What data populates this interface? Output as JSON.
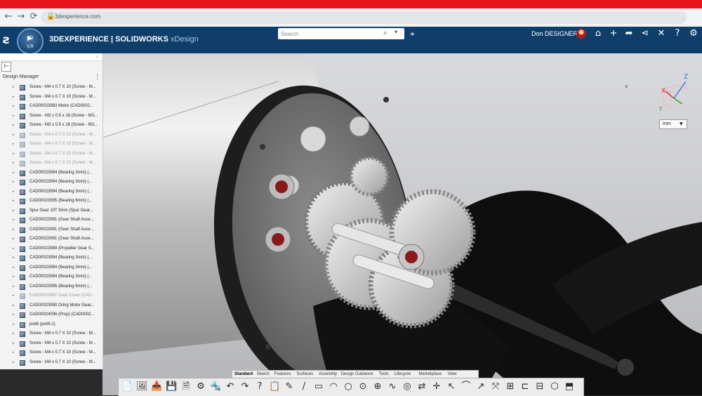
{
  "browser": {
    "url": "3dexperience.com",
    "nav": [
      "←",
      "→",
      "⟳"
    ]
  },
  "app": {
    "brand": "3DEXPERIENCE | SOLIDWORKS",
    "app_name": "xDesign",
    "compass": {
      "top": "3D",
      "bottom": "V,R"
    }
  },
  "search": {
    "placeholder": "Search"
  },
  "user": {
    "name": "Don DESIGNER"
  },
  "design_manager": {
    "title": "Design Manager",
    "items": [
      {
        "label": "Screw - M4 x 0.7 X 10 (Screw - M...",
        "dim": false
      },
      {
        "label": "Screw - M4 x 0.7 X 10 (Screw - M...",
        "dim": false
      },
      {
        "label": "CAD00023983 Motor (CAD0002...",
        "dim": false
      },
      {
        "label": "Screw - M3 x 0.5 x 16 (Screw - M3...",
        "dim": false
      },
      {
        "label": "Screw - M3 x 0.5 x 16 (Screw - M3...",
        "dim": false
      },
      {
        "label": "Screw - M4 x 0.7 X 10 (Screw - M...",
        "dim": true
      },
      {
        "label": "Screw - M4 x 0.7 X 10 (Screw - M...",
        "dim": true
      },
      {
        "label": "Screw - M4 x 0.7 X 10 (Screw - M...",
        "dim": true
      },
      {
        "label": "Screw - M4 x 0.7 X 10 (Screw - M...",
        "dim": true
      },
      {
        "label": "CAD00023994 (Bearing 3mm) (...",
        "dim": false
      },
      {
        "label": "CAD00023994 (Bearing 3mm) (...",
        "dim": false
      },
      {
        "label": "CAD00023994 (Bearing 3mm) (...",
        "dim": false
      },
      {
        "label": "CAD00023995 (Bearing 6mm) (...",
        "dim": false
      },
      {
        "label": "Spur Gear 10T 9mm (Spur Gear...",
        "dim": false
      },
      {
        "label": "CAD00023991 (Gear Shaft Asse...",
        "dim": false
      },
      {
        "label": "CAD00023991 (Gear Shaft Asse...",
        "dim": false
      },
      {
        "label": "CAD00023991 (Gear Shaft Asse...",
        "dim": false
      },
      {
        "label": "CAD00023989 (Propeller Gear S...",
        "dim": false
      },
      {
        "label": "CAD00023994 (Bearing 3mm) (...",
        "dim": false
      },
      {
        "label": "CAD00023994 (Bearing 3mm) (...",
        "dim": false
      },
      {
        "label": "CAD00023994 (Bearing 3mm) (...",
        "dim": false
      },
      {
        "label": "CAD00023995 (Bearing 6mm) (...",
        "dim": false
      },
      {
        "label": "CAD00023997 Gear Cover (CAD...",
        "dim": true
      },
      {
        "label": "CAD00023990 Oring Motor Gear...",
        "dim": false
      },
      {
        "label": "CAD00024006 (Prop) (CAD0002...",
        "dim": false
      },
      {
        "label": "pcb6 (pcb6.1)",
        "dim": false
      },
      {
        "label": "Screw - M4 x 0.7 X 10 (Screw - M...",
        "dim": false
      },
      {
        "label": "Screw - M4 x 0.7 X 10 (Screw - M...",
        "dim": false
      },
      {
        "label": "Screw - M4 x 0.7 X 10 (Screw - M...",
        "dim": false
      },
      {
        "label": "Screw - M4 x 0.7 X 10 (Screw - M...",
        "dim": false
      }
    ]
  },
  "triad": {
    "x": "X",
    "y": "Y",
    "z": "Z"
  },
  "units": {
    "value": "mm"
  },
  "command_tabs": [
    "Standard",
    "Sketch",
    "Features",
    "Surfaces",
    "Assembly",
    "Design Guidance",
    "Tools",
    "Lifecycle",
    "Marketplace",
    "View"
  ],
  "toolbar_icons": [
    "📄",
    "🖼",
    "📥",
    "💾",
    "🗎",
    "⚙",
    "🔩",
    "↶",
    "↷",
    "?",
    "📋",
    "✎",
    "/",
    "▭",
    "◠",
    "○",
    "⊙",
    "⊕",
    "∿",
    "◎",
    "⇄",
    "✛",
    "↖",
    "⌒",
    "↗",
    "⤧",
    "⊞",
    "⊏",
    "⊟",
    "⬡",
    "⬒"
  ],
  "colors": {
    "red_strip": "#e8141c",
    "app_bar": "#0f3e6b",
    "accent": "#a9c8e8"
  }
}
